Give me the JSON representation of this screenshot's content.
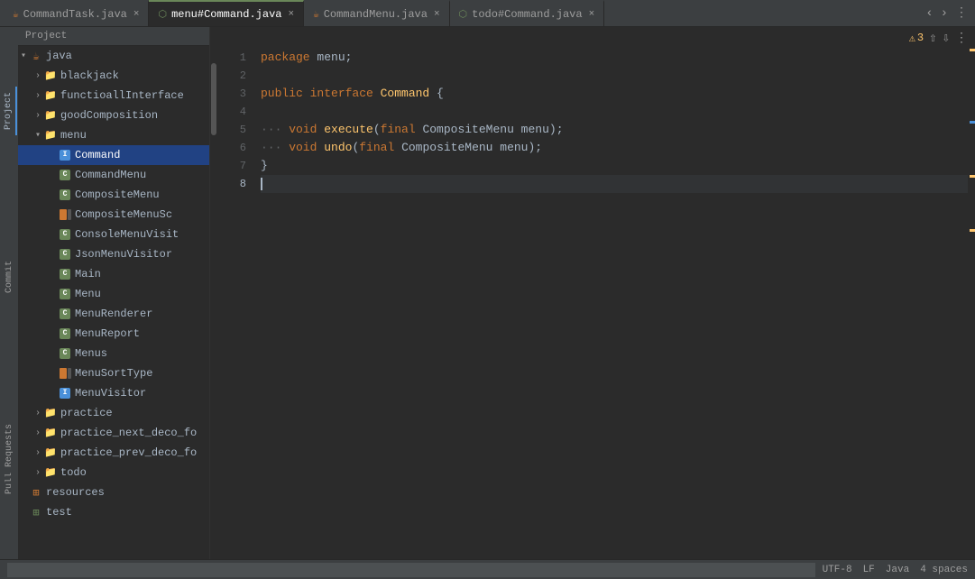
{
  "tabs": [
    {
      "id": "commandtask",
      "label": "CommandTask.java",
      "icon": "☕",
      "active": false,
      "closable": true
    },
    {
      "id": "menu-command",
      "label": "menu#Command.java",
      "icon": "⬡",
      "active": true,
      "closable": true
    },
    {
      "id": "commandmenu",
      "label": "CommandMenu.java",
      "icon": "☕",
      "active": false,
      "closable": true
    },
    {
      "id": "todo-command",
      "label": "todo#Command.java",
      "icon": "⬡",
      "active": false,
      "closable": true
    }
  ],
  "tab_actions": {
    "scroll_left": "‹",
    "scroll_right": "›",
    "more": "⋮"
  },
  "project": {
    "header": "Project",
    "tree": [
      {
        "id": "java",
        "label": "java",
        "type": "root",
        "icon": "☕",
        "indent": 0,
        "expanded": true
      },
      {
        "id": "blackjack",
        "label": "blackjack",
        "type": "folder",
        "indent": 1,
        "expanded": false
      },
      {
        "id": "functioallInterface",
        "label": "functioallInterface",
        "type": "folder",
        "indent": 1,
        "expanded": false
      },
      {
        "id": "goodComposition",
        "label": "goodComposition",
        "type": "folder",
        "indent": 1,
        "expanded": false
      },
      {
        "id": "menu",
        "label": "menu",
        "type": "folder",
        "indent": 1,
        "expanded": true
      },
      {
        "id": "Command",
        "label": "Command",
        "type": "interface",
        "indent": 2,
        "selected": true
      },
      {
        "id": "CommandMenu",
        "label": "CommandMenu",
        "type": "class",
        "indent": 2
      },
      {
        "id": "CompositeMenu",
        "label": "CompositeMenu",
        "type": "class",
        "indent": 2
      },
      {
        "id": "CompositeMenuSc",
        "label": "CompositeMenuSc",
        "type": "class-multi",
        "indent": 2
      },
      {
        "id": "ConsoleMenuVisit",
        "label": "ConsoleMenuVisit",
        "type": "class",
        "indent": 2
      },
      {
        "id": "JsonMenuVisitor",
        "label": "JsonMenuVisitor",
        "type": "class",
        "indent": 2
      },
      {
        "id": "Main",
        "label": "Main",
        "type": "class",
        "indent": 2
      },
      {
        "id": "Menu",
        "label": "Menu",
        "type": "class",
        "indent": 2
      },
      {
        "id": "MenuRenderer",
        "label": "MenuRenderer",
        "type": "class",
        "indent": 2
      },
      {
        "id": "MenuReport",
        "label": "MenuReport",
        "type": "class",
        "indent": 2
      },
      {
        "id": "Menus",
        "label": "Menus",
        "type": "class",
        "indent": 2
      },
      {
        "id": "MenuSortType",
        "label": "MenuSortType",
        "type": "class-multi",
        "indent": 2
      },
      {
        "id": "MenuVisitor",
        "label": "MenuVisitor",
        "type": "interface",
        "indent": 2
      },
      {
        "id": "practice",
        "label": "practice",
        "type": "folder",
        "indent": 1,
        "expanded": false
      },
      {
        "id": "practice_next_deco_fo",
        "label": "practice_next_deco_fo",
        "type": "folder",
        "indent": 1,
        "expanded": false
      },
      {
        "id": "practice_prev_deco_fo",
        "label": "practice_prev_deco_fo",
        "type": "folder",
        "indent": 1,
        "expanded": false
      },
      {
        "id": "todo",
        "label": "todo",
        "type": "folder",
        "indent": 1,
        "expanded": false
      },
      {
        "id": "resources",
        "label": "resources",
        "type": "root2",
        "indent": 0
      },
      {
        "id": "test",
        "label": "test",
        "type": "root3",
        "indent": 0
      }
    ]
  },
  "editor": {
    "warning_count": "3",
    "lines": [
      {
        "num": 1,
        "content": "package menu;",
        "tokens": [
          {
            "text": "package ",
            "cls": "kw"
          },
          {
            "text": "menu",
            "cls": "type"
          },
          {
            "text": ";",
            "cls": "punc"
          }
        ]
      },
      {
        "num": 2,
        "content": ""
      },
      {
        "num": 3,
        "content": "public interface Command {",
        "tokens": [
          {
            "text": "public ",
            "cls": "kw"
          },
          {
            "text": "interface ",
            "cls": "kw"
          },
          {
            "text": "Command",
            "cls": "iface"
          },
          {
            "text": " {",
            "cls": "punc"
          }
        ]
      },
      {
        "num": 4,
        "content": ""
      },
      {
        "num": 5,
        "content": "    void execute(final CompositeMenu menu);",
        "tokens": [
          {
            "text": "···",
            "cls": "comment"
          },
          {
            "text": " void ",
            "cls": "kw"
          },
          {
            "text": "execute",
            "cls": "method"
          },
          {
            "text": "(",
            "cls": "punc"
          },
          {
            "text": "final ",
            "cls": "param-kw"
          },
          {
            "text": "CompositeMenu ",
            "cls": "param-type"
          },
          {
            "text": "menu",
            "cls": "param-name"
          },
          {
            "text": ");",
            "cls": "punc"
          }
        ]
      },
      {
        "num": 6,
        "content": "    void undo(final CompositeMenu menu);",
        "tokens": [
          {
            "text": "···",
            "cls": "comment"
          },
          {
            "text": " void ",
            "cls": "kw"
          },
          {
            "text": "undo",
            "cls": "method"
          },
          {
            "text": "(",
            "cls": "punc"
          },
          {
            "text": "final ",
            "cls": "param-kw"
          },
          {
            "text": "CompositeMenu ",
            "cls": "param-type"
          },
          {
            "text": "menu",
            "cls": "param-name"
          },
          {
            "text": ");",
            "cls": "punc"
          }
        ]
      },
      {
        "num": 7,
        "content": "}",
        "tokens": [
          {
            "text": "}",
            "cls": "punc"
          }
        ]
      },
      {
        "num": 8,
        "content": ""
      }
    ]
  },
  "status_bar": {
    "input_placeholder": "",
    "items": [
      "UTF-8",
      "LF",
      "Java",
      "4 spaces"
    ]
  },
  "sidebar_labels": [
    "Project",
    "Commit",
    "Pull Requests"
  ]
}
